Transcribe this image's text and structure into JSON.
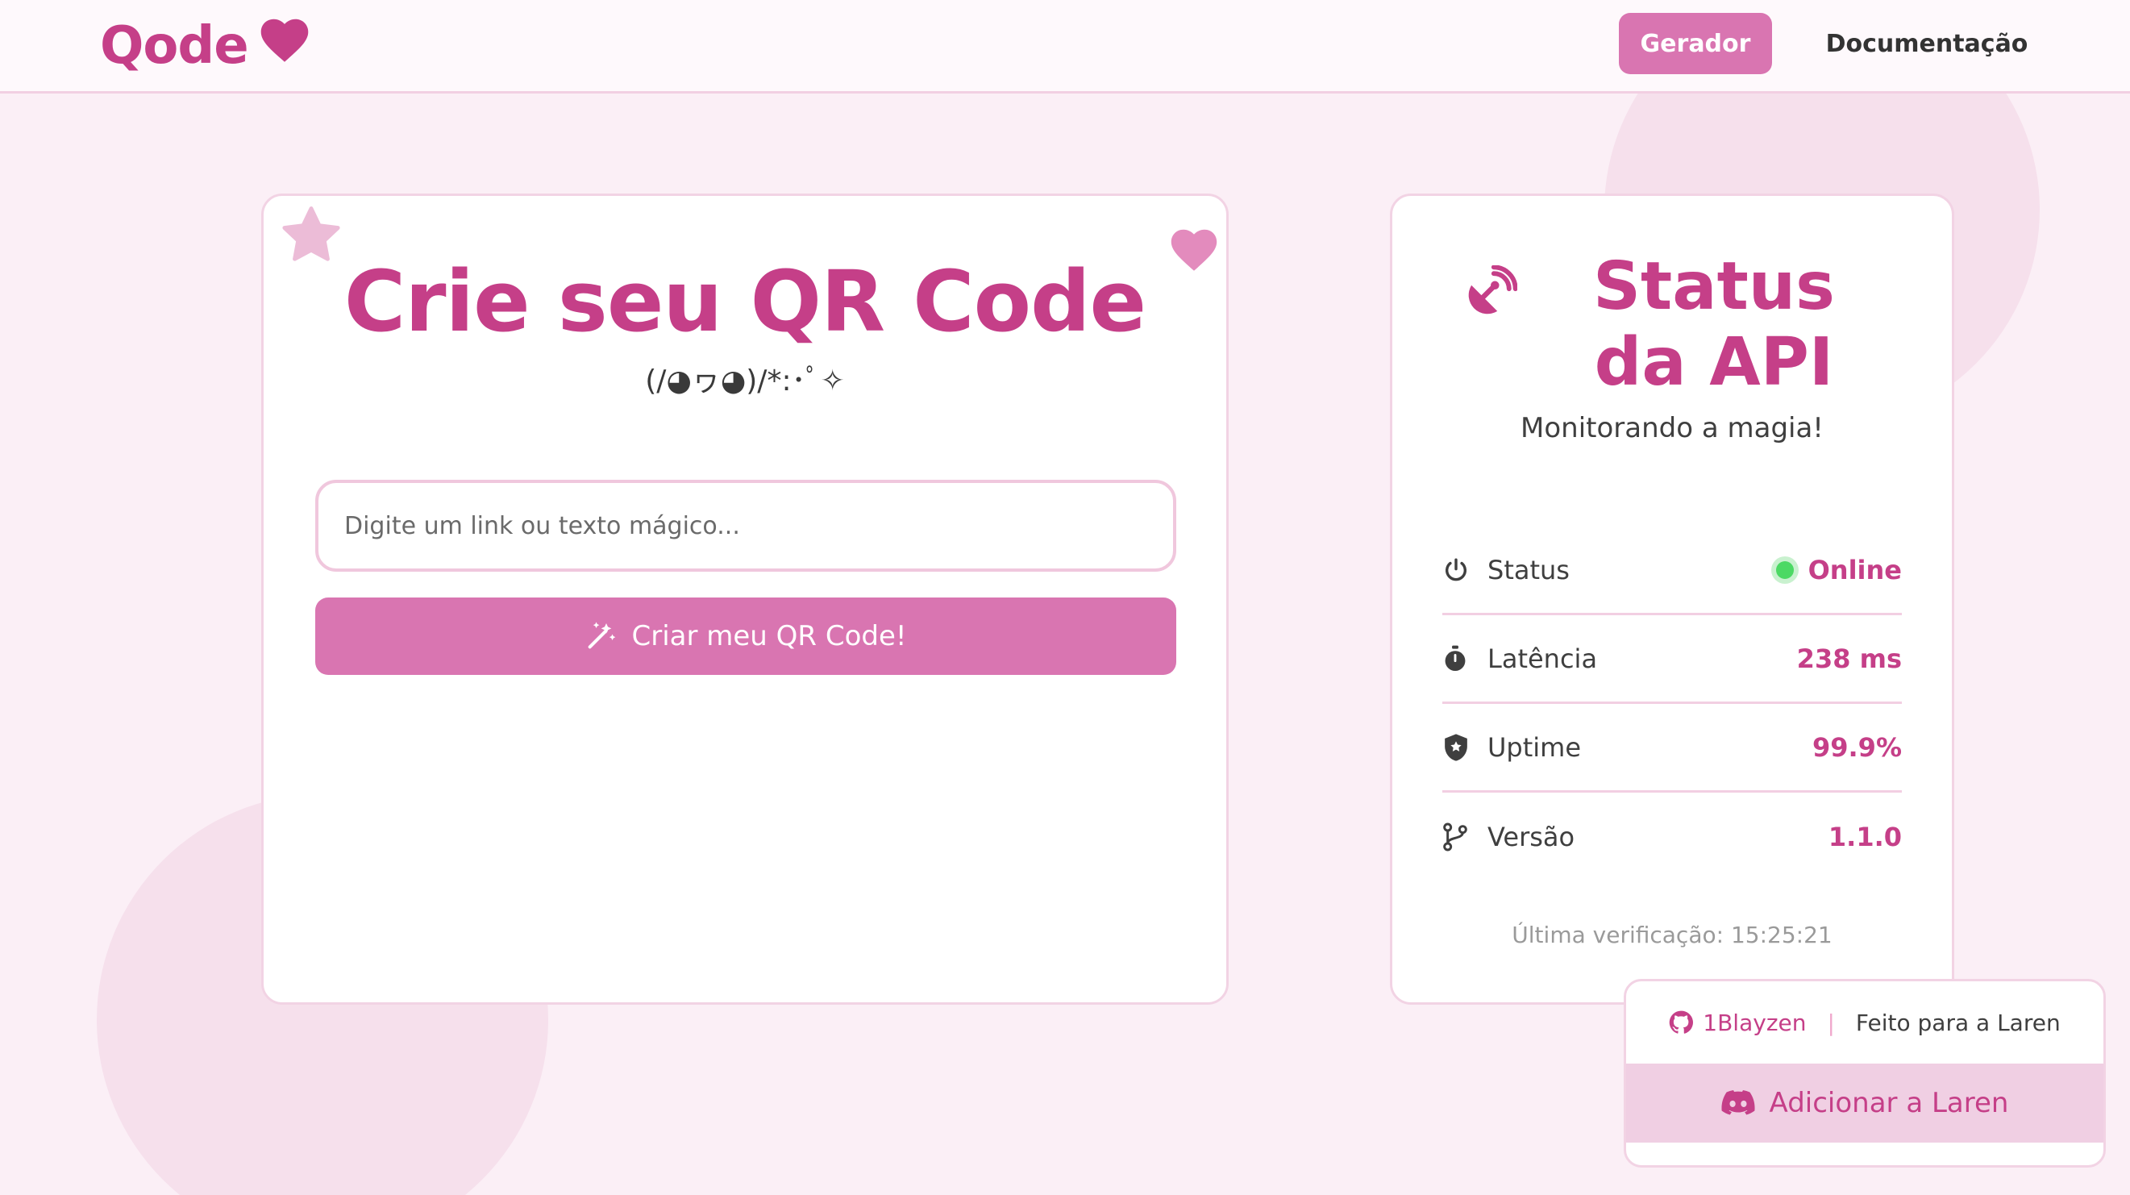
{
  "header": {
    "logo": "Qode",
    "nav": [
      {
        "label": "Gerador",
        "active": true
      },
      {
        "label": "Documentação",
        "active": false
      }
    ]
  },
  "generator": {
    "title": "Crie seu QR Code",
    "kaomoji": "(/◕ヮ◕)/*:･ﾟ✧",
    "input_placeholder": "Digite um link ou texto mágico...",
    "button_label": "Criar meu QR Code!"
  },
  "status": {
    "title": "Status da API",
    "subtitle": "Monitorando a magia!",
    "rows": [
      {
        "label": "Status",
        "value": "Online",
        "icon": "power-icon"
      },
      {
        "label": "Latência",
        "value": "238 ms",
        "icon": "stopwatch-icon"
      },
      {
        "label": "Uptime",
        "value": "99.9%",
        "icon": "shield-icon"
      },
      {
        "label": "Versão",
        "value": "1.1.0",
        "icon": "branch-icon"
      }
    ],
    "last_check": "Última verificação: 15:25:21"
  },
  "footer": {
    "github_user": "1Blayzen",
    "separator": "|",
    "made_for": "Feito para a Laren",
    "discord_button": "Adicionar a Laren"
  },
  "colors": {
    "accent": "#c53f88",
    "button": "#d975b1",
    "background": "#fbeff6",
    "online": "#4cd964"
  }
}
